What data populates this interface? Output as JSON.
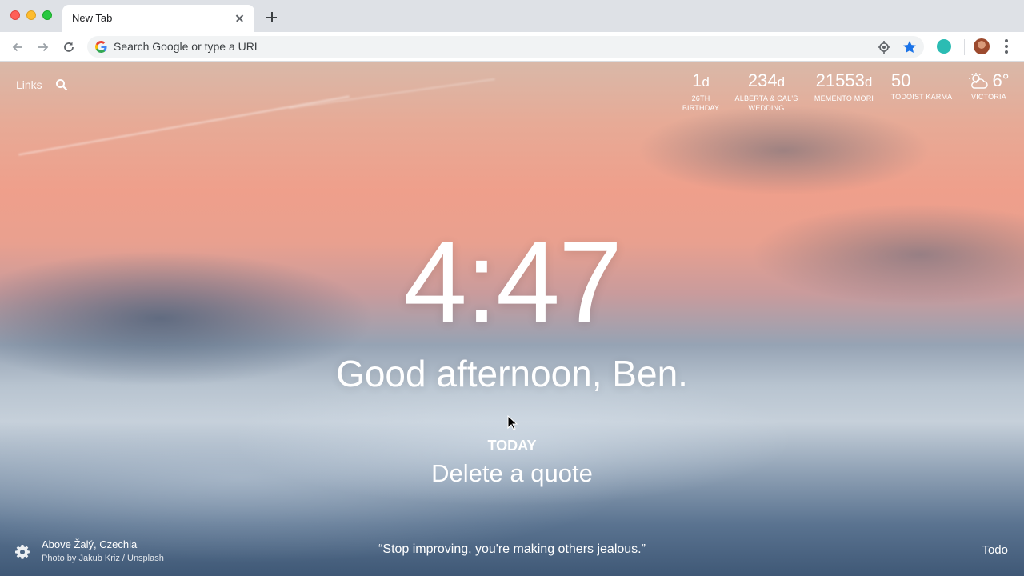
{
  "browser": {
    "tab_title": "New Tab",
    "omnibox_placeholder": "Search Google or type a URL",
    "icons": [
      "back-icon",
      "forward-icon",
      "reload-icon",
      "google-icon",
      "location-icon",
      "star-icon",
      "extension-icon",
      "avatar",
      "menu-icon",
      "close-icon",
      "plus-icon"
    ],
    "colors": {
      "star": "#1a73e8",
      "extension": "#2bbcb3"
    }
  },
  "momentum": {
    "links_label": "Links",
    "counters": [
      {
        "value": "1",
        "unit": "d",
        "label": "26TH BIRTHDAY"
      },
      {
        "value": "234",
        "unit": "d",
        "label": "ALBERTA & CAL'S WEDDING"
      },
      {
        "value": "21553",
        "unit": "d",
        "label": "MEMENTO MORI"
      },
      {
        "value": "50",
        "unit": "",
        "label": "TODOIST KARMA"
      }
    ],
    "weather": {
      "temp": "6°",
      "location": "VICTORIA",
      "icon": "partly-cloudy-icon"
    },
    "time": "4:47",
    "greeting": "Good afternoon, Ben.",
    "focus_label": "TODAY",
    "focus_text": "Delete a quote",
    "photo_location": "Above Žalý, Czechia",
    "photo_credit": "Photo by Jakub Kriz / Unsplash",
    "quote": "“Stop improving, you're making others jealous.”",
    "todo_label": "Todo"
  }
}
